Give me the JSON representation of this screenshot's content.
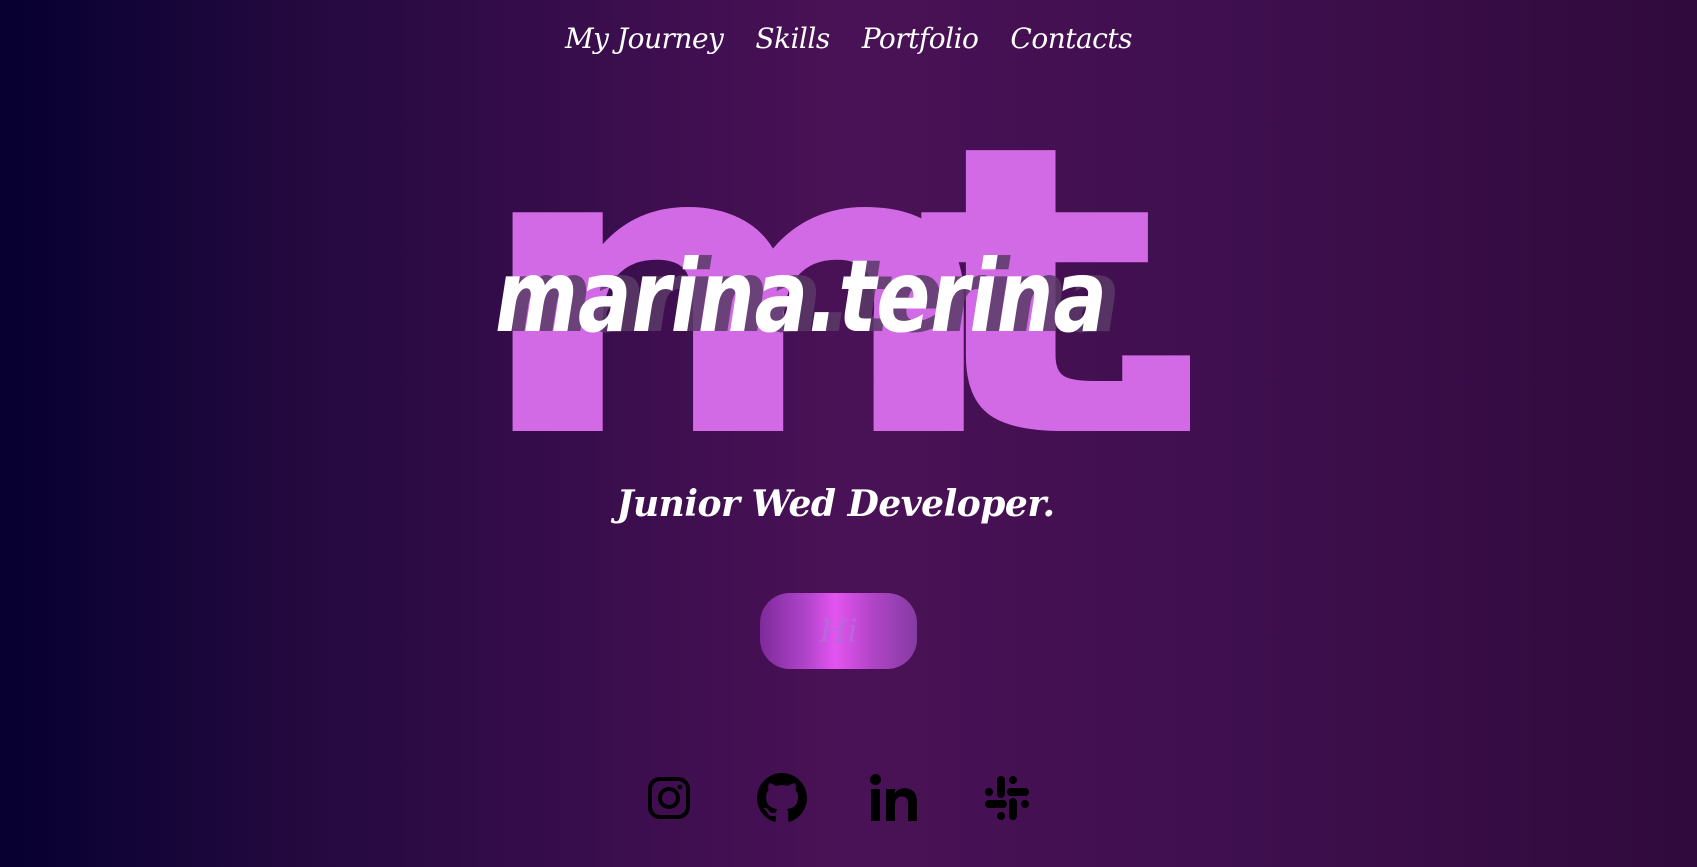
{
  "nav": {
    "items": [
      {
        "label": "My Journey"
      },
      {
        "label": "Skills"
      },
      {
        "label": "Portfolio"
      },
      {
        "label": "Contacts"
      }
    ]
  },
  "logo": {
    "monogram": "mt.",
    "wordmark": "marina.terina"
  },
  "hero": {
    "subtitle": "Junior Wed Developer.",
    "button_label": "Hi"
  },
  "socials": [
    {
      "icon": "instagram-icon"
    },
    {
      "icon": "github-icon"
    },
    {
      "icon": "linkedin-icon"
    },
    {
      "icon": "slack-icon"
    }
  ],
  "colors": {
    "accent": "#d26ae6",
    "background_dark": "#060030",
    "background_mid": "#4a1256",
    "text": "#ffffff"
  }
}
